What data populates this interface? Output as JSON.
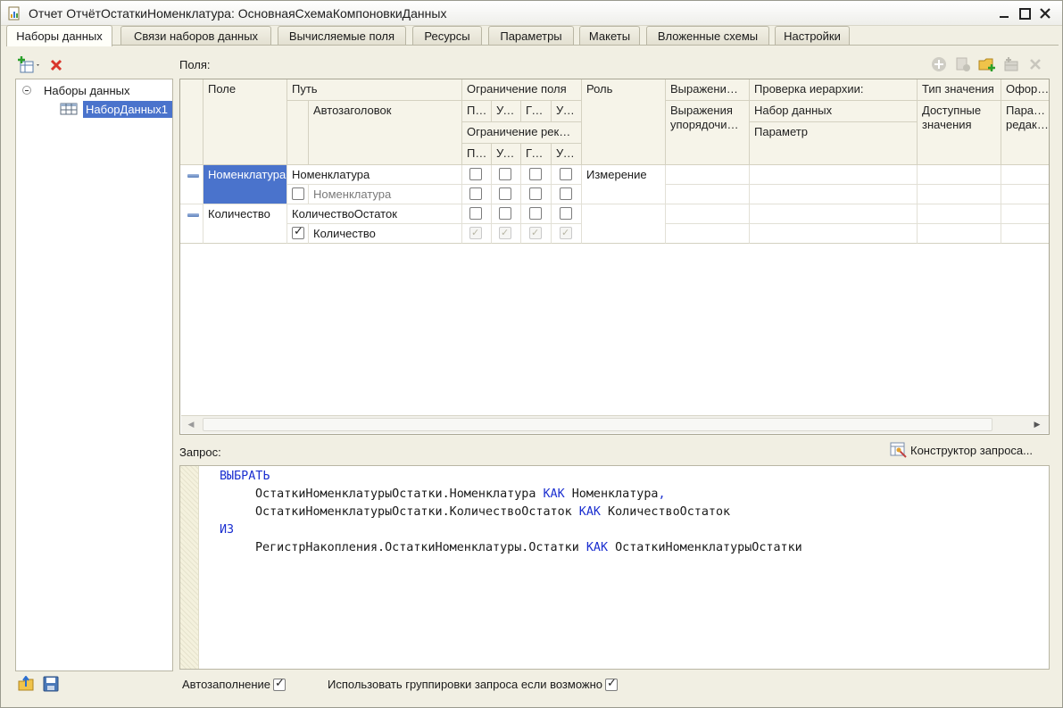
{
  "window": {
    "title": "Отчет ОтчётОстаткиНоменклатура: ОсновнаяСхемаКомпоновкиДанных"
  },
  "tabs": [
    {
      "label": "Наборы данных",
      "active": true
    },
    {
      "label": "Связи наборов данных",
      "active": false
    },
    {
      "label": "Вычисляемые поля",
      "active": false
    },
    {
      "label": "Ресурсы",
      "active": false
    },
    {
      "label": "Параметры",
      "active": false
    },
    {
      "label": "Макеты",
      "active": false
    },
    {
      "label": "Вложенные схемы",
      "active": false
    },
    {
      "label": "Настройки",
      "active": false
    }
  ],
  "tree": {
    "root": "Наборы данных",
    "child": "НаборДанных1"
  },
  "fields": {
    "label": "Поля:",
    "headers": {
      "field": "Поле",
      "path": "Путь",
      "autotitle": "Автозаголовок",
      "field_restriction": "Ограничение поля",
      "restr_cols": [
        "Поле",
        "Условие",
        "Группировка",
        "Упорядочивание"
      ],
      "attr_restriction": "Ограничение реквизитов",
      "role": "Роль",
      "expression": "Выражение представления",
      "order_expressions": "Выражения упорядочивания",
      "hierarchy_check": "Проверка иерархии:",
      "dataset": "Набор данных",
      "parameter": "Параметр",
      "value_type": "Тип значения",
      "available_values": "Доступные значения",
      "format": "Оформление",
      "edit_params": "Параметры редактирования"
    },
    "rows": [
      {
        "field": "Номенклатура",
        "path": "Номенклатура",
        "title": "Номенклатура",
        "autotitle_checked": false,
        "role": "Измерение",
        "field_restr": [
          false,
          false,
          false,
          false
        ],
        "attr_restr": [
          false,
          false,
          false,
          false
        ],
        "attr_restr_disabled": false
      },
      {
        "field": "Количество",
        "path": "КоличествоОстаток",
        "title": "Количество",
        "autotitle_checked": true,
        "role": "",
        "field_restr": [
          false,
          false,
          false,
          false
        ],
        "attr_restr": [
          true,
          true,
          true,
          true
        ],
        "attr_restr_disabled": true
      }
    ]
  },
  "query": {
    "label": "Запрос:",
    "constructor_label": "Конструктор запроса...",
    "lines": [
      {
        "indent": 0,
        "parts": [
          {
            "t": "ВЫБРАТЬ",
            "kw": true
          }
        ]
      },
      {
        "indent": 1,
        "parts": [
          {
            "t": "ОстаткиНоменклатурыОстатки.Номенклатура ",
            "kw": false
          },
          {
            "t": "КАК",
            "kw": true
          },
          {
            "t": " Номенклатура",
            "kw": false
          },
          {
            "t": ",",
            "kw": true
          }
        ]
      },
      {
        "indent": 1,
        "parts": [
          {
            "t": "ОстаткиНоменклатурыОстатки.КоличествоОстаток ",
            "kw": false
          },
          {
            "t": "КАК",
            "kw": true
          },
          {
            "t": " КоличествоОстаток",
            "kw": false
          }
        ]
      },
      {
        "indent": 0,
        "parts": [
          {
            "t": "ИЗ",
            "kw": true
          }
        ]
      },
      {
        "indent": 1,
        "parts": [
          {
            "t": "РегистрНакопления.ОстаткиНоменклатуры.Остатки ",
            "kw": false
          },
          {
            "t": "КАК",
            "kw": true
          },
          {
            "t": " ОстаткиНоменклатурыОстатки",
            "kw": false
          }
        ]
      }
    ]
  },
  "footer": {
    "autofill_label": "Автозаполнение",
    "autofill_checked": true,
    "use_grouping_label": "Использовать группировки запроса если возможно",
    "use_grouping_checked": true
  },
  "icons": {
    "title": "report-icon",
    "add": "add-dataset-icon",
    "delete": "delete-icon",
    "tree_item": "table-icon",
    "open": "open-folder-icon",
    "save": "save-icon",
    "constructor": "query-constructor-icon"
  },
  "colors": {
    "selection": "#4a73cc",
    "keyword": "#1b2fd0",
    "delete": "#d9352b"
  }
}
